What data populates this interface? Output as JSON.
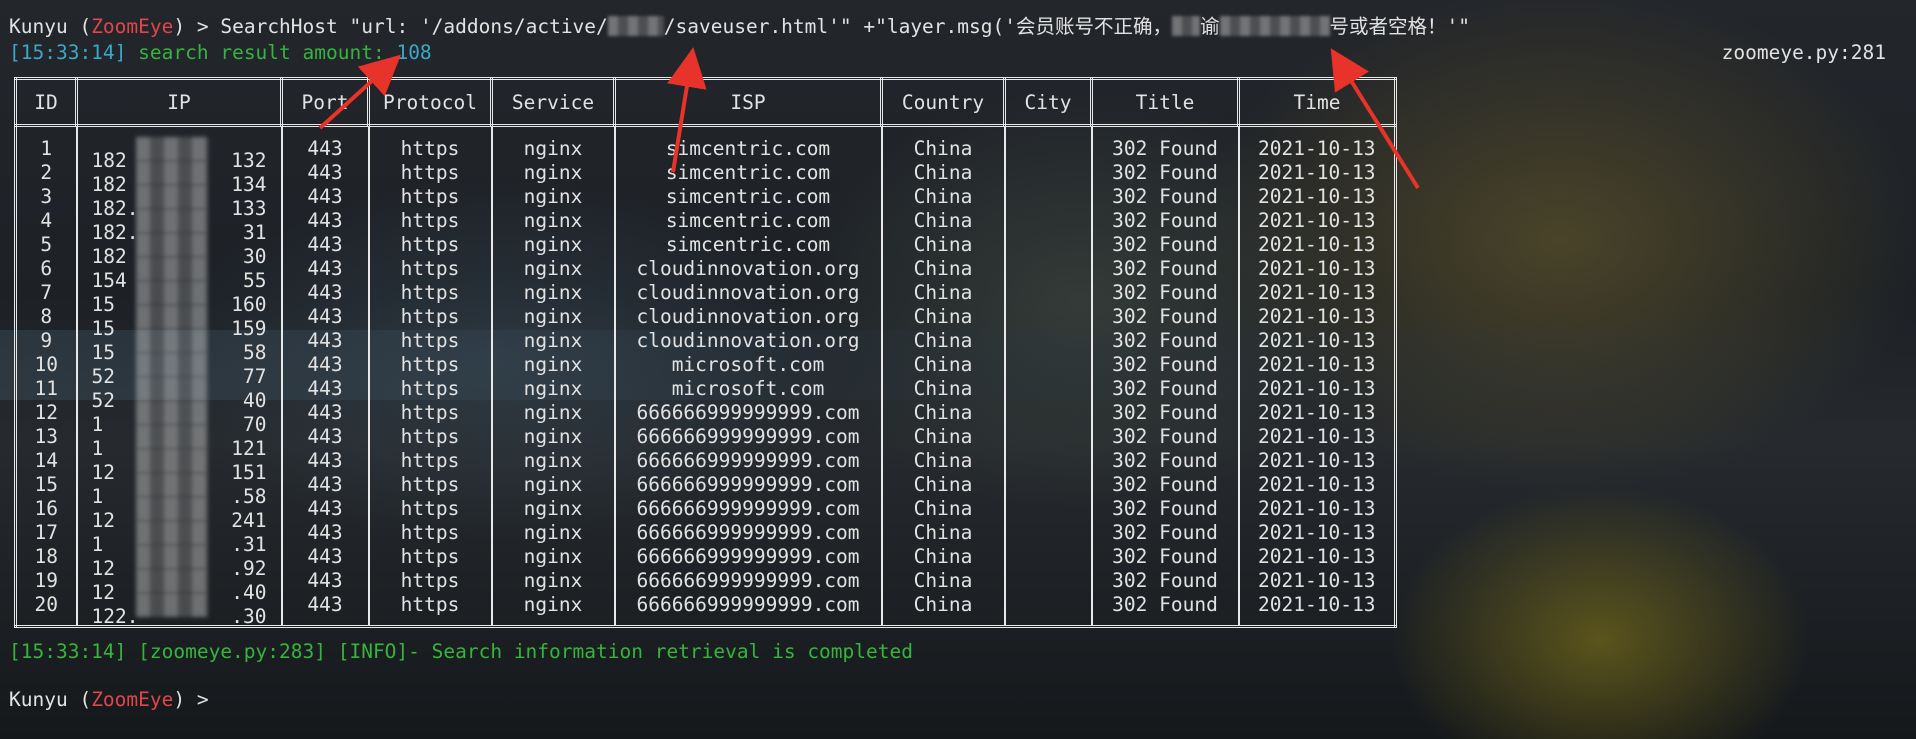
{
  "terminal": {
    "prompt_user": "Kunyu",
    "prompt_app": "ZoomEye",
    "prompt_symbol": ">",
    "command_part1": "SearchHost \"url: '/addons/active/",
    "command_part2": "/saveuser.html'\" +\"layer.msg('会员账号不正确，",
    "command_part3": "谕",
    "command_part4": "号或者空格！'\"",
    "amount_timestamp": "[15:33:14]",
    "amount_label": "search result amount:",
    "amount_value": "108",
    "amount_location": "zoomeye.py:281",
    "info_line": "[15:33:14] [zoomeye.py:283] [INFO]- Search information retrieval is completed"
  },
  "table": {
    "headers": [
      "ID",
      "IP",
      "Port",
      "Protocol",
      "Service",
      "ISP",
      "Country",
      "City",
      "Title",
      "Time"
    ],
    "rows": [
      {
        "id": "1",
        "ip_start": "182",
        "ip_end": "132",
        "port": "443",
        "protocol": "https",
        "service": "nginx",
        "isp": "simcentric.com",
        "country": "China",
        "city": "",
        "title": "302 Found",
        "time": "2021-10-13"
      },
      {
        "id": "2",
        "ip_start": "182",
        "ip_end": "134",
        "port": "443",
        "protocol": "https",
        "service": "nginx",
        "isp": "simcentric.com",
        "country": "China",
        "city": "",
        "title": "302 Found",
        "time": "2021-10-13"
      },
      {
        "id": "3",
        "ip_start": "182.",
        "ip_end": "133",
        "port": "443",
        "protocol": "https",
        "service": "nginx",
        "isp": "simcentric.com",
        "country": "China",
        "city": "",
        "title": "302 Found",
        "time": "2021-10-13"
      },
      {
        "id": "4",
        "ip_start": "182.",
        "ip_end": "31",
        "port": "443",
        "protocol": "https",
        "service": "nginx",
        "isp": "simcentric.com",
        "country": "China",
        "city": "",
        "title": "302 Found",
        "time": "2021-10-13"
      },
      {
        "id": "5",
        "ip_start": "182",
        "ip_end": "30",
        "port": "443",
        "protocol": "https",
        "service": "nginx",
        "isp": "simcentric.com",
        "country": "China",
        "city": "",
        "title": "302 Found",
        "time": "2021-10-13"
      },
      {
        "id": "6",
        "ip_start": "154",
        "ip_end": "55",
        "port": "443",
        "protocol": "https",
        "service": "nginx",
        "isp": "cloudinnovation.org",
        "country": "China",
        "city": "",
        "title": "302 Found",
        "time": "2021-10-13"
      },
      {
        "id": "7",
        "ip_start": "15",
        "ip_end": "160",
        "port": "443",
        "protocol": "https",
        "service": "nginx",
        "isp": "cloudinnovation.org",
        "country": "China",
        "city": "",
        "title": "302 Found",
        "time": "2021-10-13"
      },
      {
        "id": "8",
        "ip_start": "15",
        "ip_end": "159",
        "port": "443",
        "protocol": "https",
        "service": "nginx",
        "isp": "cloudinnovation.org",
        "country": "China",
        "city": "",
        "title": "302 Found",
        "time": "2021-10-13"
      },
      {
        "id": "9",
        "ip_start": "15",
        "ip_end": "58",
        "port": "443",
        "protocol": "https",
        "service": "nginx",
        "isp": "cloudinnovation.org",
        "country": "China",
        "city": "",
        "title": "302 Found",
        "time": "2021-10-13"
      },
      {
        "id": "10",
        "ip_start": "52",
        "ip_end": "77",
        "port": "443",
        "protocol": "https",
        "service": "nginx",
        "isp": "microsoft.com",
        "country": "China",
        "city": "",
        "title": "302 Found",
        "time": "2021-10-13"
      },
      {
        "id": "11",
        "ip_start": "52",
        "ip_end": "40",
        "port": "443",
        "protocol": "https",
        "service": "nginx",
        "isp": "microsoft.com",
        "country": "China",
        "city": "",
        "title": "302 Found",
        "time": "2021-10-13"
      },
      {
        "id": "12",
        "ip_start": "1",
        "ip_end": "70",
        "port": "443",
        "protocol": "https",
        "service": "nginx",
        "isp": "666666999999999.com",
        "country": "China",
        "city": "",
        "title": "302 Found",
        "time": "2021-10-13"
      },
      {
        "id": "13",
        "ip_start": "1",
        "ip_end": "121",
        "port": "443",
        "protocol": "https",
        "service": "nginx",
        "isp": "666666999999999.com",
        "country": "China",
        "city": "",
        "title": "302 Found",
        "time": "2021-10-13"
      },
      {
        "id": "14",
        "ip_start": "12",
        "ip_end": "151",
        "port": "443",
        "protocol": "https",
        "service": "nginx",
        "isp": "666666999999999.com",
        "country": "China",
        "city": "",
        "title": "302 Found",
        "time": "2021-10-13"
      },
      {
        "id": "15",
        "ip_start": "1",
        "ip_end": ".58",
        "port": "443",
        "protocol": "https",
        "service": "nginx",
        "isp": "666666999999999.com",
        "country": "China",
        "city": "",
        "title": "302 Found",
        "time": "2021-10-13"
      },
      {
        "id": "16",
        "ip_start": "12",
        "ip_end": "241",
        "port": "443",
        "protocol": "https",
        "service": "nginx",
        "isp": "666666999999999.com",
        "country": "China",
        "city": "",
        "title": "302 Found",
        "time": "2021-10-13"
      },
      {
        "id": "17",
        "ip_start": "1",
        "ip_end": ".31",
        "port": "443",
        "protocol": "https",
        "service": "nginx",
        "isp": "666666999999999.com",
        "country": "China",
        "city": "",
        "title": "302 Found",
        "time": "2021-10-13"
      },
      {
        "id": "18",
        "ip_start": "12",
        "ip_end": ".92",
        "port": "443",
        "protocol": "https",
        "service": "nginx",
        "isp": "666666999999999.com",
        "country": "China",
        "city": "",
        "title": "302 Found",
        "time": "2021-10-13"
      },
      {
        "id": "19",
        "ip_start": "12",
        "ip_end": ".40",
        "port": "443",
        "protocol": "https",
        "service": "nginx",
        "isp": "666666999999999.com",
        "country": "China",
        "city": "",
        "title": "302 Found",
        "time": "2021-10-13"
      },
      {
        "id": "20",
        "ip_start": "122.",
        "ip_end": ".30",
        "port": "443",
        "protocol": "https",
        "service": "nginx",
        "isp": "666666999999999.com",
        "country": "China",
        "city": "",
        "title": "302 Found",
        "time": "2021-10-13"
      }
    ]
  },
  "colors": {
    "prompt_app": "#e0464a",
    "timestamp": "#3ba8c8",
    "success": "#36b43e",
    "arrow": "#e8332a"
  }
}
